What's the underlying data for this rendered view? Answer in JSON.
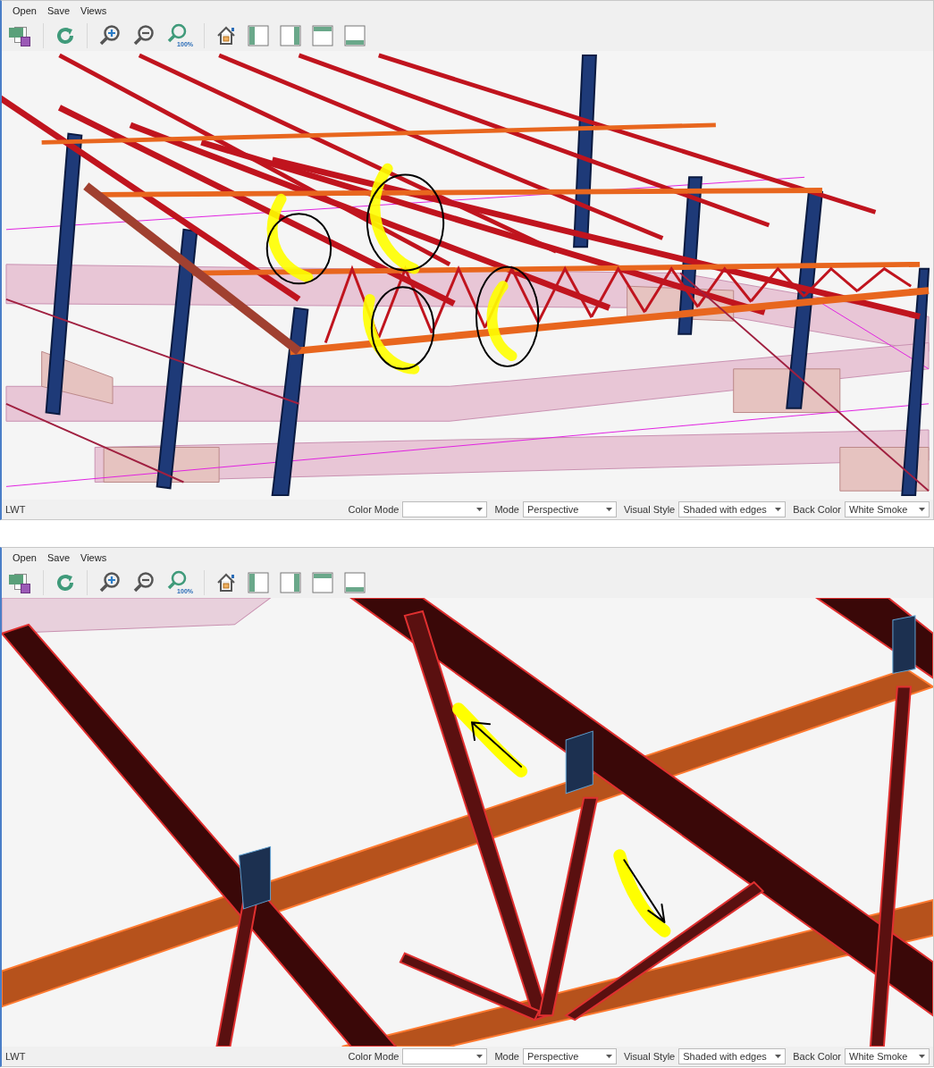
{
  "windows": [
    {
      "kind": "overview",
      "menu": [
        "Open",
        "Save",
        "Views"
      ],
      "toolbar": {
        "zoom_label": "100%"
      },
      "status": {
        "label": "LWT",
        "fields": [
          {
            "label": "Color Mode"
          },
          {
            "label": "Mode",
            "value": "Perspective"
          },
          {
            "label": "Visual Style",
            "value": "Shaded with edges"
          },
          {
            "label": "Back Color",
            "value": "White Smoke"
          }
        ]
      }
    },
    {
      "kind": "closeup",
      "menu": [
        "Open",
        "Save",
        "Views"
      ],
      "toolbar": {
        "zoom_label": "100%"
      },
      "status": {
        "label": "LWT",
        "fields": [
          {
            "label": "Color Mode"
          },
          {
            "label": "Mode",
            "value": "Perspective"
          },
          {
            "label": "Visual Style",
            "value": "Shaded with edges"
          },
          {
            "label": "Back Color",
            "value": "White Smoke"
          }
        ]
      }
    }
  ]
}
